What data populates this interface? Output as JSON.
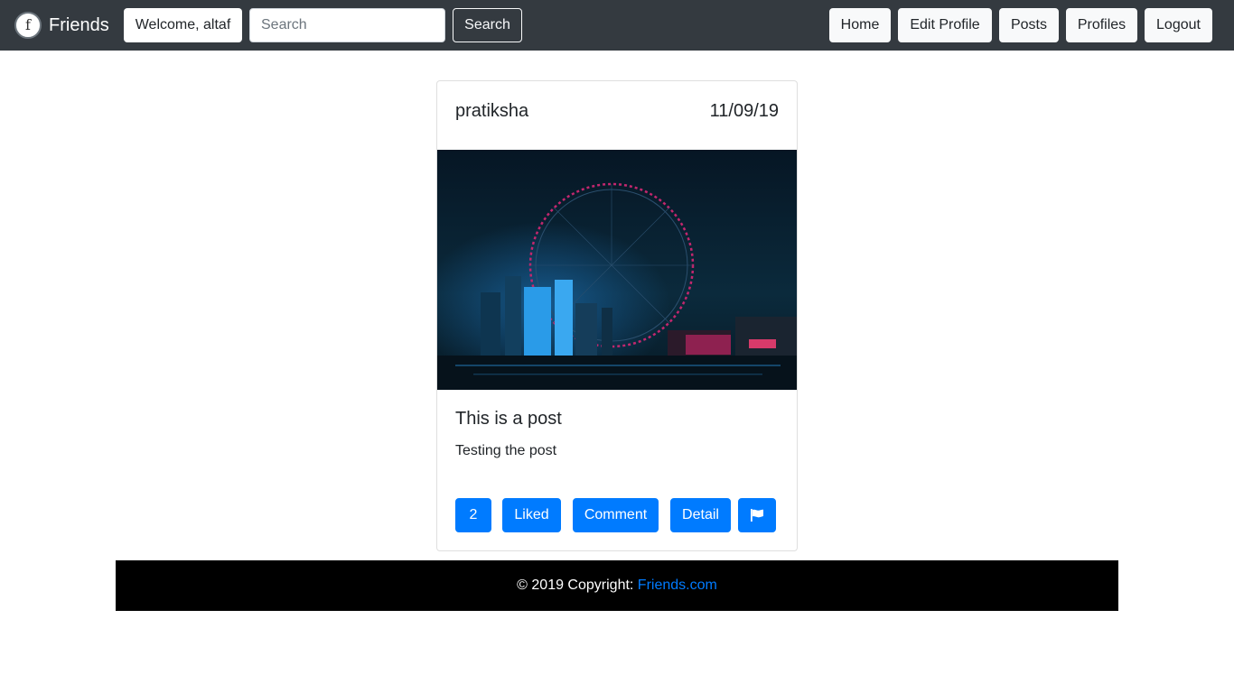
{
  "navbar": {
    "brand": {
      "logo_icon": "friends-f-logo-icon",
      "label": "Friends"
    },
    "welcome": "Welcome, altaf",
    "search": {
      "placeholder": "Search",
      "value": "",
      "button_label": "Search"
    },
    "links": {
      "home": "Home",
      "edit_profile": "Edit Profile",
      "posts": "Posts",
      "profiles": "Profiles",
      "logout": "Logout"
    }
  },
  "post": {
    "author": "pratiksha",
    "date": "11/09/19",
    "title": "This is a post",
    "body": "Testing the post",
    "actions": {
      "like_count": "2",
      "liked_label": "Liked",
      "comment_label": "Comment",
      "detail_label": "Detail",
      "flag_icon": "flag-icon"
    }
  },
  "footer": {
    "copyright": "© 2019 Copyright: ",
    "link_text": "Friends.com"
  },
  "colors": {
    "navbar_bg": "#343a40",
    "primary": "#007bff",
    "footer_bg": "#000000"
  }
}
